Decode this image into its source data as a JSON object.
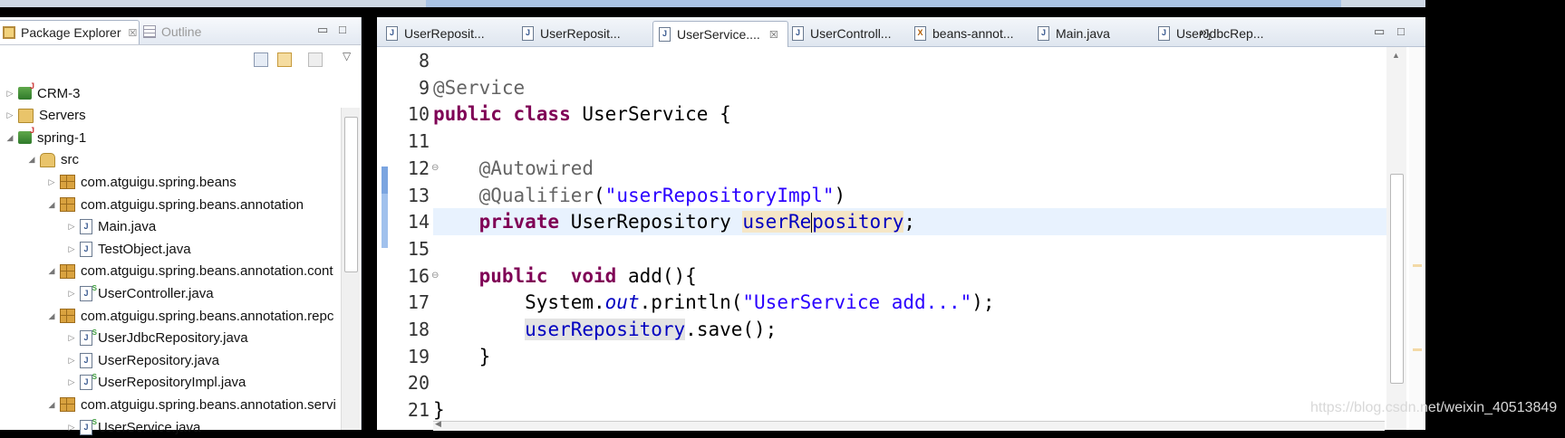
{
  "explorer": {
    "tabs": [
      {
        "label": "Package Explorer",
        "close": "☒"
      },
      {
        "label": "Outline"
      }
    ],
    "tree": [
      {
        "label": "CRM-3",
        "icon": "project-icon",
        "expanded": false,
        "level": 0
      },
      {
        "label": "Servers",
        "icon": "folder-icon",
        "expanded": false,
        "level": 0
      },
      {
        "label": "spring-1",
        "icon": "project-icon",
        "expanded": true,
        "level": 0
      },
      {
        "label": "src",
        "icon": "source-folder-icon",
        "expanded": true,
        "level": 1
      },
      {
        "label": "com.atguigu.spring.beans",
        "icon": "package-icon",
        "expanded": false,
        "level": 2
      },
      {
        "label": "com.atguigu.spring.beans.annotation",
        "icon": "package-icon",
        "expanded": true,
        "level": 2
      },
      {
        "label": "Main.java",
        "icon": "java-file-icon",
        "expanded": false,
        "level": 3
      },
      {
        "label": "TestObject.java",
        "icon": "java-file-icon",
        "expanded": false,
        "level": 3
      },
      {
        "label": "com.atguigu.spring.beans.annotation.cont",
        "icon": "package-icon",
        "expanded": true,
        "level": 2
      },
      {
        "label": "UserController.java",
        "icon": "spring-java-file-icon",
        "expanded": false,
        "level": 3
      },
      {
        "label": "com.atguigu.spring.beans.annotation.repc",
        "icon": "package-icon",
        "expanded": true,
        "level": 2
      },
      {
        "label": "UserJdbcRepository.java",
        "icon": "spring-java-file-icon",
        "expanded": false,
        "level": 3
      },
      {
        "label": "UserRepository.java",
        "icon": "java-file-icon",
        "expanded": false,
        "level": 3
      },
      {
        "label": "UserRepositoryImpl.java",
        "icon": "spring-java-file-icon",
        "expanded": false,
        "level": 3
      },
      {
        "label": "com.atguigu.spring.beans.annotation.servi",
        "icon": "package-icon",
        "expanded": true,
        "level": 2
      },
      {
        "label": "UserService.java",
        "icon": "spring-java-file-icon",
        "expanded": false,
        "level": 3
      }
    ]
  },
  "editor": {
    "tabs": [
      {
        "label": "UserReposit...",
        "type": "J",
        "active": false
      },
      {
        "label": "UserReposit...",
        "type": "J",
        "active": false
      },
      {
        "label": "UserService....",
        "type": "J",
        "active": true,
        "close": "☒"
      },
      {
        "label": "UserControll...",
        "type": "J",
        "active": false
      },
      {
        "label": "beans-annot...",
        "type": "X",
        "active": false
      },
      {
        "label": "Main.java",
        "type": "J",
        "active": false
      },
      {
        "label": "UserJdbcRep...",
        "type": "J",
        "active": false
      }
    ],
    "overflow": "»",
    "overflow_count": "1",
    "lines": [
      {
        "num": "8",
        "fold": false,
        "current": false,
        "tokens": []
      },
      {
        "num": "9",
        "fold": false,
        "current": false,
        "tokens": [
          {
            "t": "@Service",
            "c": "ann"
          }
        ]
      },
      {
        "num": "10",
        "fold": false,
        "current": false,
        "tokens": [
          {
            "t": "public class ",
            "c": "kw"
          },
          {
            "t": "UserService {",
            "c": ""
          }
        ]
      },
      {
        "num": "11",
        "fold": false,
        "current": false,
        "tokens": []
      },
      {
        "num": "12",
        "fold": true,
        "current": false,
        "tokens": [
          {
            "t": "    ",
            "c": ""
          },
          {
            "t": "@Autowired",
            "c": "ann"
          }
        ]
      },
      {
        "num": "13",
        "fold": false,
        "current": false,
        "tokens": [
          {
            "t": "    ",
            "c": ""
          },
          {
            "t": "@Qualifier",
            "c": "ann"
          },
          {
            "t": "(",
            "c": ""
          },
          {
            "t": "\"userRepositoryImpl\"",
            "c": "str"
          },
          {
            "t": ")",
            "c": ""
          }
        ]
      },
      {
        "num": "14",
        "fold": false,
        "current": true,
        "tokens": [
          {
            "t": "    ",
            "c": ""
          },
          {
            "t": "private ",
            "c": "kw"
          },
          {
            "t": "UserRepository ",
            "c": ""
          },
          {
            "t": "userRe",
            "c": "fld occw"
          },
          {
            "t": "|",
            "c": "caret"
          },
          {
            "t": "pository",
            "c": "fld occw"
          },
          {
            "t": ";",
            "c": ""
          }
        ]
      },
      {
        "num": "15",
        "fold": false,
        "current": false,
        "tokens": []
      },
      {
        "num": "16",
        "fold": true,
        "current": false,
        "tokens": [
          {
            "t": "    ",
            "c": ""
          },
          {
            "t": "public  void ",
            "c": "kw"
          },
          {
            "t": "add(){",
            "c": ""
          }
        ]
      },
      {
        "num": "17",
        "fold": false,
        "current": false,
        "tokens": [
          {
            "t": "        System.",
            "c": ""
          },
          {
            "t": "out",
            "c": "sfld"
          },
          {
            "t": ".println(",
            "c": ""
          },
          {
            "t": "\"UserService add...\"",
            "c": "str"
          },
          {
            "t": ");",
            "c": ""
          }
        ]
      },
      {
        "num": "18",
        "fold": false,
        "current": false,
        "tokens": [
          {
            "t": "        ",
            "c": ""
          },
          {
            "t": "userRepository",
            "c": "fld occ"
          },
          {
            "t": ".save();",
            "c": ""
          }
        ]
      },
      {
        "num": "19",
        "fold": false,
        "current": false,
        "tokens": [
          {
            "t": "    }",
            "c": ""
          }
        ]
      },
      {
        "num": "20",
        "fold": false,
        "current": false,
        "tokens": []
      },
      {
        "num": "21",
        "fold": false,
        "current": false,
        "tokens": [
          {
            "t": "}",
            "c": ""
          }
        ]
      }
    ]
  },
  "watermark": "https://blog.csdn.net/weixin_40513849"
}
